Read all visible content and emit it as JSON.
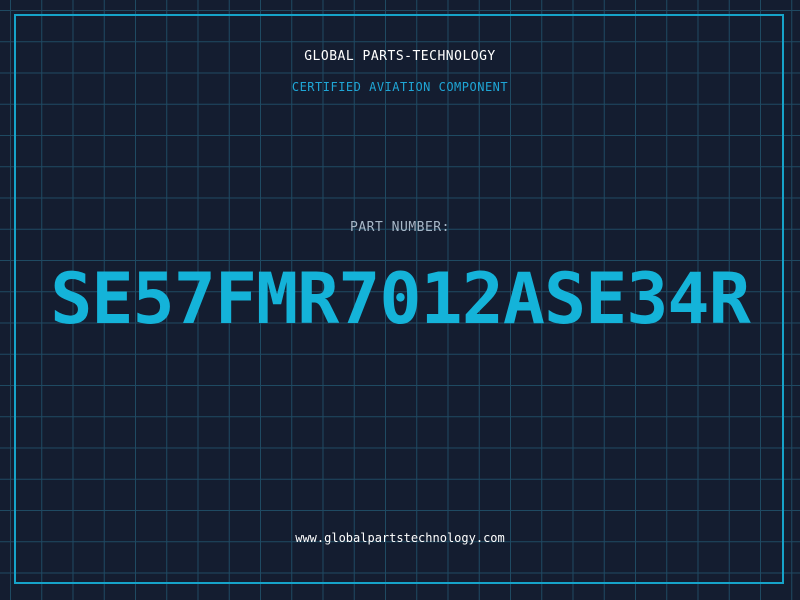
{
  "header": {
    "company": "GLOBAL PARTS-TECHNOLOGY",
    "tagline": "CERTIFIED AVIATION COMPONENT"
  },
  "part": {
    "label": "PART NUMBER:",
    "number": "SE57FMR7012ASE34R"
  },
  "footer": {
    "website": "www.globalpartstechnology.com"
  },
  "colors": {
    "background": "#141d30",
    "grid": "#1f4a63",
    "accent": "#14b3d9",
    "border": "#16a3c9"
  }
}
